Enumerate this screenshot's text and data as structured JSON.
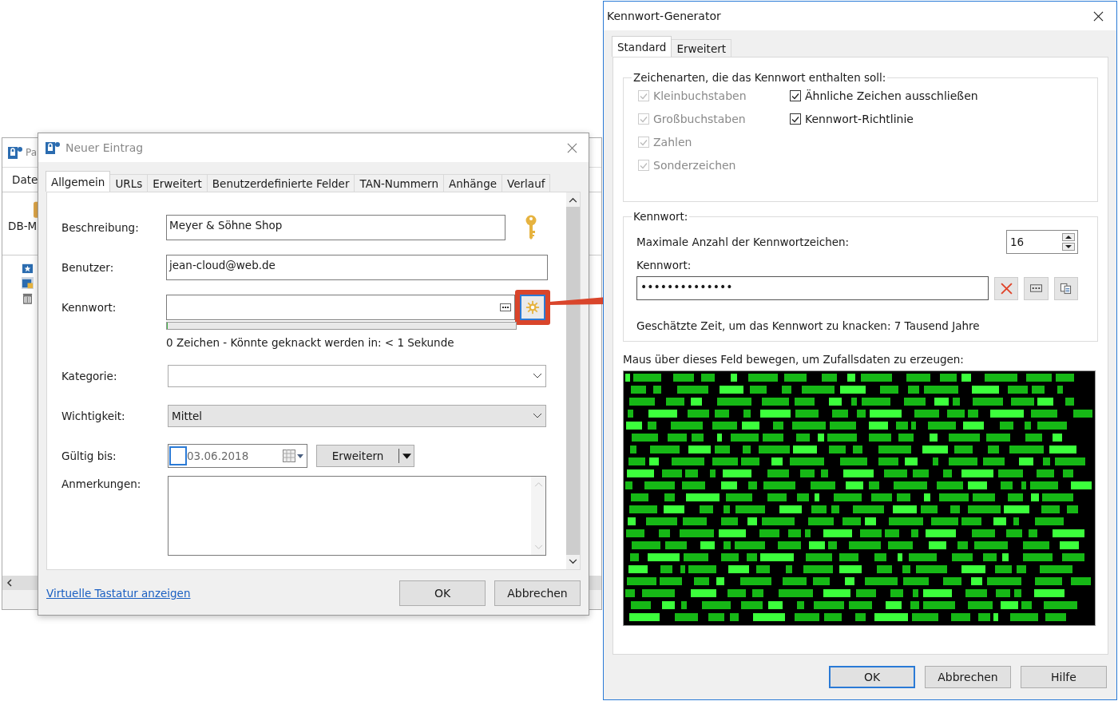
{
  "background_window": {
    "title": "Pa",
    "menu": [
      "Date"
    ],
    "toolbar_label": "DB-M"
  },
  "entry_dialog": {
    "title": "Neuer Eintrag",
    "tabs": [
      {
        "label": "Allgemein",
        "selected": true
      },
      {
        "label": "URLs",
        "selected": false
      },
      {
        "label": "Erweitert",
        "selected": false
      },
      {
        "label": "Benutzerdefinierte Felder",
        "selected": false
      },
      {
        "label": "TAN-Nummern",
        "selected": false
      },
      {
        "label": "Anhänge",
        "selected": false
      },
      {
        "label": "Verlauf",
        "selected": false
      }
    ],
    "description": {
      "label": "Beschreibung:",
      "value": "Meyer & Söhne Shop"
    },
    "user": {
      "label": "Benutzer:",
      "value": "jean-cloud@web.de"
    },
    "password": {
      "label": "Kennwort:",
      "strength": {
        "level": 0
      },
      "strength_text": "0 Zeichen - Könnte geknackt werden in: < 1 Sekunde"
    },
    "category": {
      "label": "Kategorie:"
    },
    "importance": {
      "label": "Wichtigkeit:",
      "value": "Mittel"
    },
    "valid_until": {
      "label": "Gültig bis:",
      "checked": false,
      "value": "03.06.2018",
      "expand_button": "Erweitern"
    },
    "notes": {
      "label": "Anmerkungen:"
    },
    "link": "Virtuelle Tastatur anzeigen",
    "buttons": [
      "OK",
      "Abbrechen"
    ]
  },
  "generator": {
    "title": "Kennwort-Generator",
    "tabs": [
      {
        "label": "Standard",
        "selected": true
      },
      {
        "label": "Erweitert",
        "selected": false
      }
    ],
    "char_group": "Zeichenarten, die das Kennwort enthalten soll:",
    "options_left": [
      {
        "label": "Kleinbuchstaben",
        "checked": true,
        "disabled": true
      },
      {
        "label": "Großbuchstaben",
        "checked": true,
        "disabled": true
      },
      {
        "label": "Zahlen",
        "checked": true,
        "disabled": true
      },
      {
        "label": "Sonderzeichen",
        "checked": true,
        "disabled": true
      }
    ],
    "options_right": [
      {
        "label": "Ähnliche Zeichen ausschließen",
        "checked": true,
        "disabled": false
      },
      {
        "label": "Kennwort-Richtlinie",
        "checked": true,
        "disabled": false
      }
    ],
    "password_group": "Kennwort:",
    "max_label": "Maximale Anzahl der Kennwortzeichen:",
    "max_value": "16",
    "password_label": "Kennwort:",
    "password_value": "••••••••••••••",
    "estimate": "Geschätzte Zeit, um das Kennwort zu knacken: 7 Tausend Jahre",
    "random_label": "Maus über dieses Feld bewegen, um Zufallsdaten zu erzeugen:",
    "buttons": [
      {
        "label": "OK",
        "selected": true
      },
      {
        "label": "Abbrechen",
        "selected": false
      },
      {
        "label": "Hilfe",
        "selected": false
      }
    ]
  }
}
